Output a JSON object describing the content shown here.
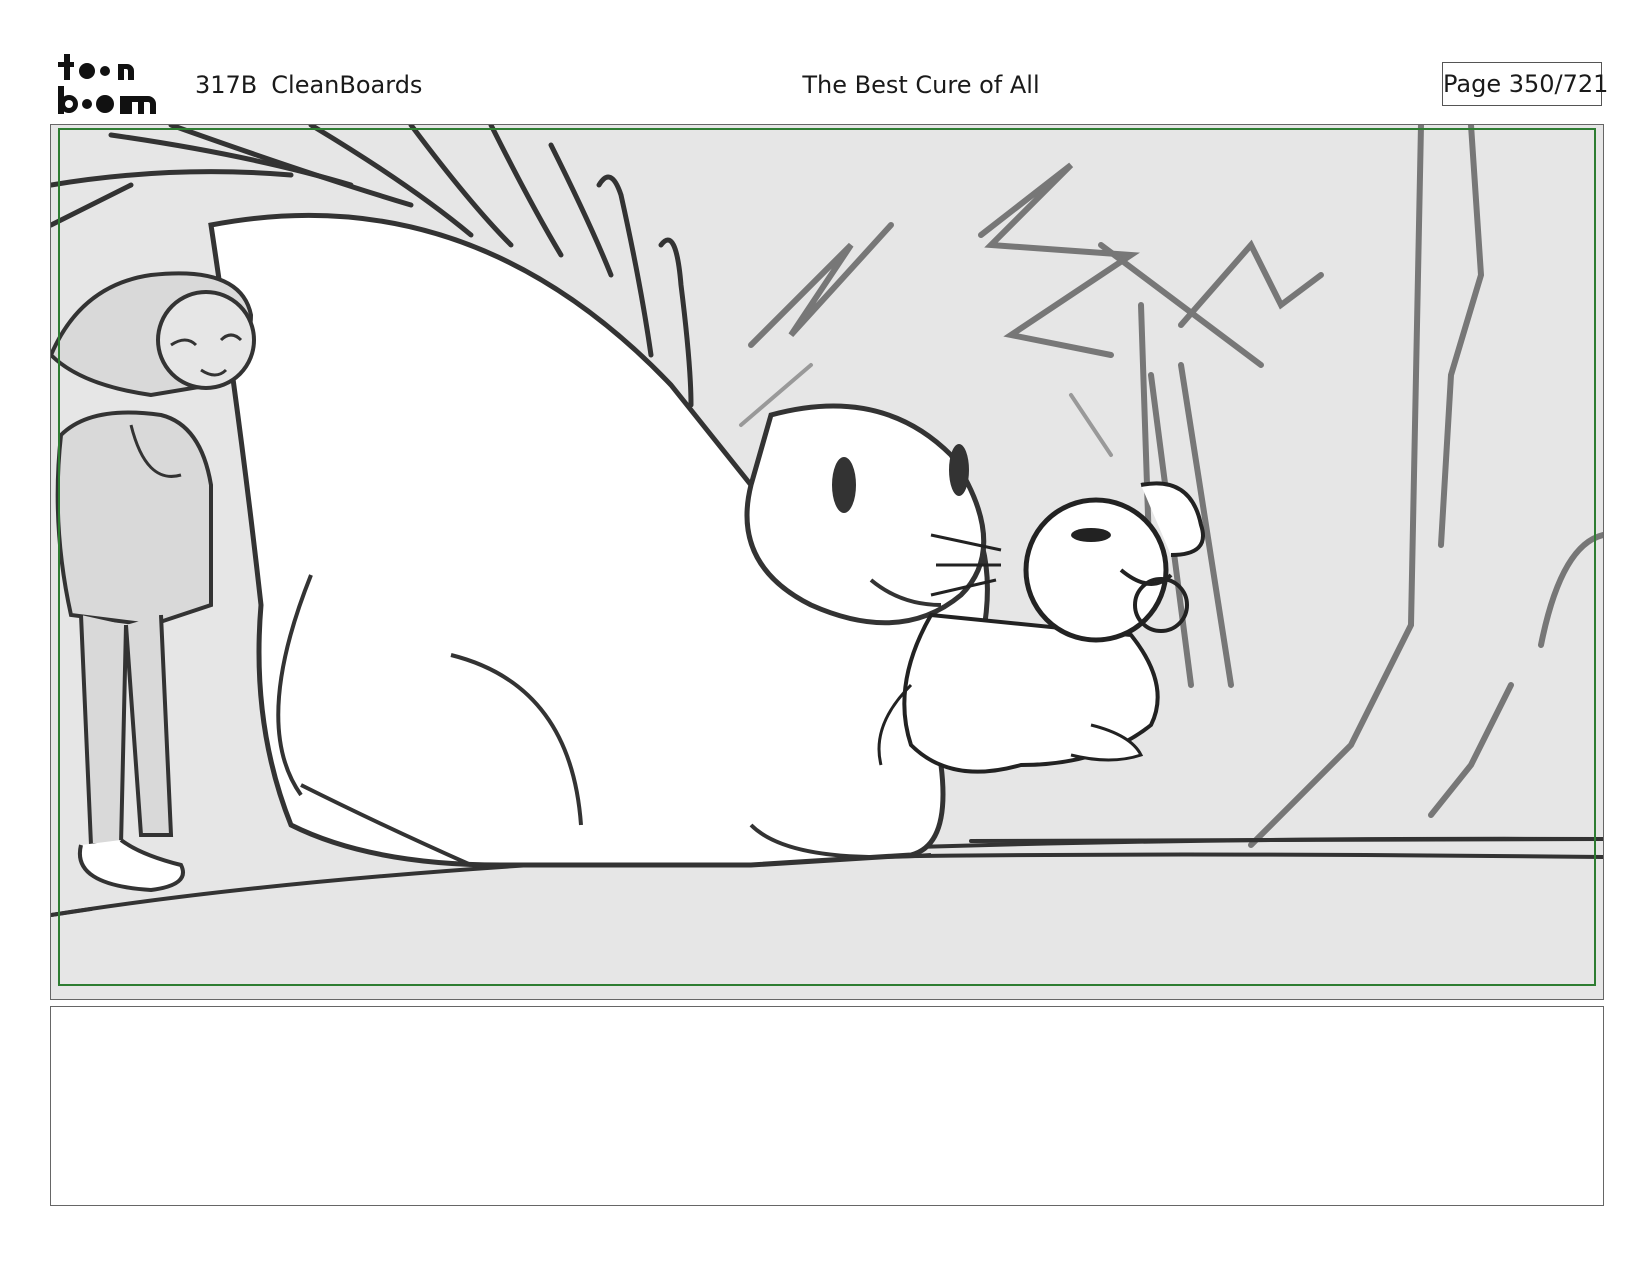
{
  "header": {
    "logo": {
      "line1": "toon",
      "line2": "boom",
      "icon": "toon-boom-logo"
    },
    "episode": "317B",
    "board_name": "CleanBoards",
    "title": "The Best Cure of All",
    "page_label": "Page 350/721"
  },
  "panel": {
    "safe_area_color": "#2e7d32",
    "background_color": "#e6e6e6",
    "sketch_color": "#333333"
  },
  "dialogue": {
    "text": ""
  }
}
